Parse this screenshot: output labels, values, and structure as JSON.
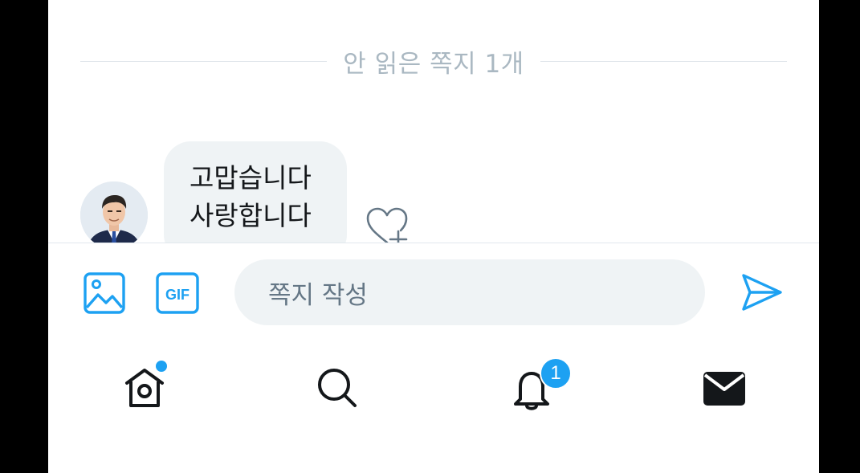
{
  "conversation": {
    "unread_divider": "안 읽은 쪽지 1개",
    "messages": [
      {
        "text": "고맙습니다\n사랑합니다",
        "sender_avatar": "avatar"
      }
    ],
    "react_icon": "heart-plus-icon"
  },
  "composer": {
    "placeholder": "쪽지 작성",
    "media_icon": "image-icon",
    "gif_label": "GIF",
    "send_icon": "send-icon"
  },
  "bottom_nav": {
    "tabs": [
      {
        "name": "home",
        "icon": "home-icon",
        "has_dot": true
      },
      {
        "name": "search",
        "icon": "search-icon"
      },
      {
        "name": "notifications",
        "icon": "bell-icon",
        "badge": "1"
      },
      {
        "name": "messages",
        "icon": "mail-icon",
        "active": true
      }
    ]
  },
  "colors": {
    "accent": "#1da1f2",
    "bubble": "#eff3f5",
    "muted_text": "#aab8c2",
    "icon_dark": "#14171a"
  }
}
